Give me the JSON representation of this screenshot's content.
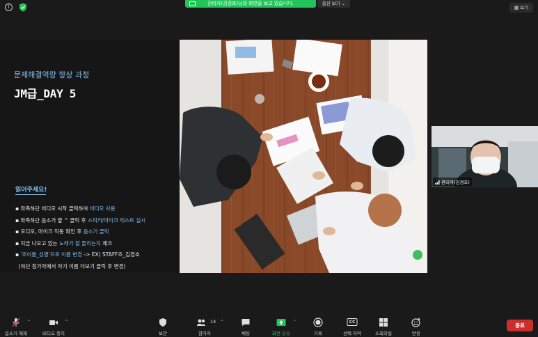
{
  "top_bar": {
    "banner_text": "관리자(김경호)님의 화면을 보고 있습니다.",
    "view_options_label": "옵션 보기",
    "view_button_label": "보기",
    "info_icon": "i"
  },
  "slide": {
    "subtitle": "문제해결역량 향상 과정",
    "title": "JM급_DAY 5",
    "notice_heading": "읽어주세요!",
    "bullets": [
      {
        "text": "좌측하단 비디오 시작 클릭하여 ",
        "highlight": "비디오 사용",
        "tail": ""
      },
      {
        "text": "좌측하단 음소거 옆 ^ 클릭 후 ",
        "highlight": "스피커/마이크 테스트 실시",
        "tail": ""
      },
      {
        "text": "오디오, 마이크 작동 확인 후 ",
        "highlight": "음소거 클릭",
        "tail": ""
      },
      {
        "text": "지금 나오고 있는 ",
        "highlight": "노래가 잘 들리는지",
        "tail": " 체크"
      },
      {
        "text": "",
        "highlight": "'조이름_성명'으로 이름 변경",
        "tail": " -> EX) STAFF조_김경호"
      },
      {
        "text": "(하단 참가자에서 자기 이름 더보기 클릭 후 변경)",
        "highlight": "",
        "tail": ""
      }
    ]
  },
  "self_video": {
    "name": "관리자(김경호)"
  },
  "bottom_bar": {
    "mute": "음소거 해제",
    "video": "비디오 중지",
    "security": "보안",
    "participants": "참가자",
    "participant_count": "14",
    "chat": "채팅",
    "share": "화면 공유",
    "record": "기록",
    "cc": "선택 자막",
    "cc_icon": "CC",
    "breakout": "소회의실",
    "reactions": "반응",
    "end": "종료",
    "caret": "^"
  },
  "colors": {
    "accent_blue": "#7fc0f0",
    "share_green": "#23c55a",
    "end_red": "#c9302c"
  }
}
